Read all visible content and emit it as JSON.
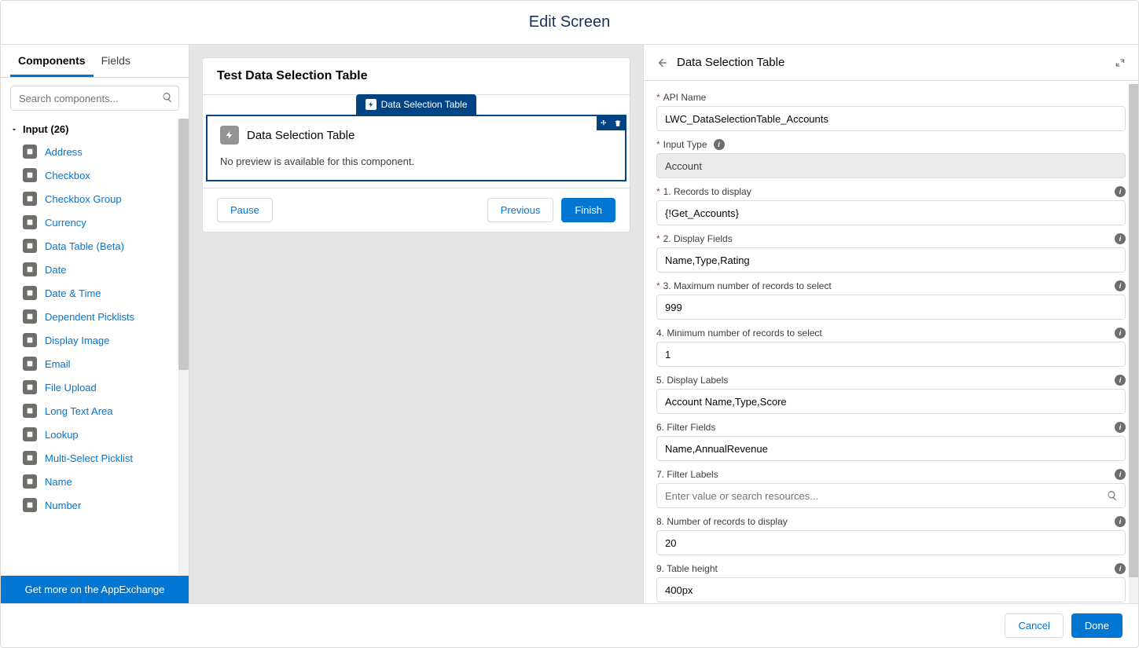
{
  "header": {
    "title": "Edit Screen"
  },
  "leftPanel": {
    "tabs": [
      {
        "label": "Components",
        "active": true
      },
      {
        "label": "Fields",
        "active": false
      }
    ],
    "searchPlaceholder": "Search components...",
    "groupLabel": "Input (26)",
    "components": [
      "Address",
      "Checkbox",
      "Checkbox Group",
      "Currency",
      "Data Table (Beta)",
      "Date",
      "Date & Time",
      "Dependent Picklists",
      "Display Image",
      "Email",
      "File Upload",
      "Long Text Area",
      "Lookup",
      "Multi-Select Picklist",
      "Name",
      "Number"
    ],
    "appExchange": "Get more on the AppExchange"
  },
  "canvas": {
    "cardTitle": "Test Data Selection Table",
    "chipLabel": "Data Selection Table",
    "selectedTitle": "Data Selection Table",
    "noPreview": "No preview is available for this component.",
    "pause": "Pause",
    "previous": "Previous",
    "finish": "Finish"
  },
  "rightPanel": {
    "title": "Data Selection Table",
    "fields": [
      {
        "label": "API Name",
        "required": true,
        "value": "LWC_DataSelectionTable_Accounts",
        "info": false,
        "readonly": false
      },
      {
        "label": "Input Type",
        "required": true,
        "value": "Account",
        "info": true,
        "infoInline": true,
        "readonly": true
      },
      {
        "label": "1. Records to display",
        "required": true,
        "value": "{!Get_Accounts}",
        "info": true,
        "readonly": false
      },
      {
        "label": "2. Display Fields",
        "required": true,
        "value": "Name,Type,Rating",
        "info": true,
        "readonly": false
      },
      {
        "label": "3. Maximum number of records to select",
        "required": true,
        "value": "999",
        "info": true,
        "readonly": false
      },
      {
        "label": "4. Minimum number of records to select",
        "required": false,
        "value": "1",
        "info": true,
        "readonly": false
      },
      {
        "label": "5. Display Labels",
        "required": false,
        "value": "Account Name,Type,Score",
        "info": true,
        "readonly": false
      },
      {
        "label": "6. Filter Fields",
        "required": false,
        "value": "Name,AnnualRevenue",
        "info": true,
        "readonly": false
      },
      {
        "label": "7. Filter Labels",
        "required": false,
        "value": "",
        "placeholder": "Enter value or search resources...",
        "info": true,
        "readonly": false,
        "search": true
      },
      {
        "label": "8. Number of records to display",
        "required": false,
        "value": "20",
        "info": true,
        "readonly": false
      },
      {
        "label": "9. Table height",
        "required": false,
        "value": "400px",
        "info": true,
        "readonly": false
      }
    ]
  },
  "footer": {
    "cancel": "Cancel",
    "done": "Done"
  }
}
